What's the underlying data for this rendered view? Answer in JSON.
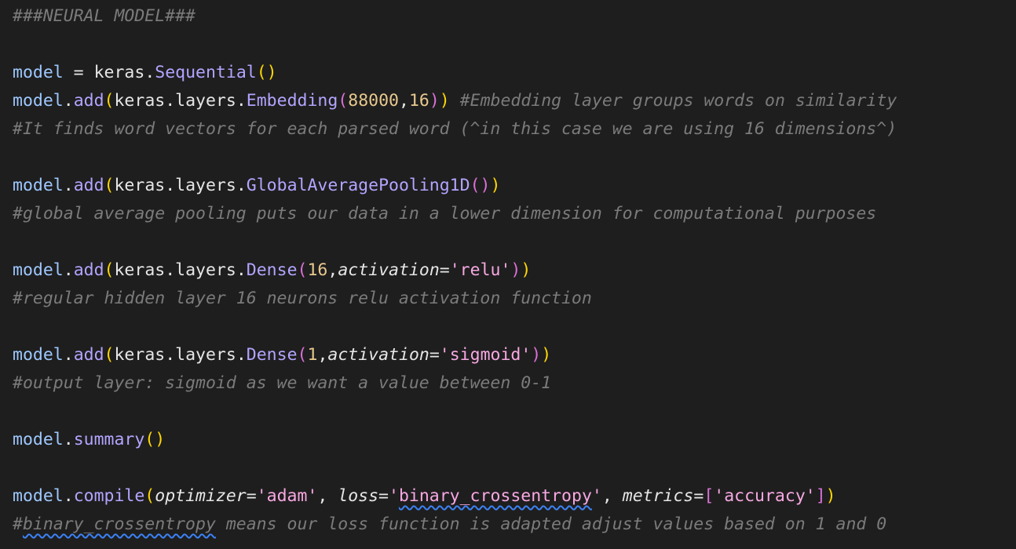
{
  "lines": [
    {
      "tokens": [
        {
          "t": "###NEURAL MODEL###",
          "c": "comment"
        }
      ]
    },
    {
      "tokens": []
    },
    {
      "tokens": [
        {
          "t": "model",
          "c": "var"
        },
        {
          "t": " = ",
          "c": "plain"
        },
        {
          "t": "keras",
          "c": "plain"
        },
        {
          "t": ".",
          "c": "plain"
        },
        {
          "t": "Sequential",
          "c": "fn"
        },
        {
          "t": "()",
          "c": "paren-y"
        }
      ]
    },
    {
      "tokens": [
        {
          "t": "model",
          "c": "var"
        },
        {
          "t": ".",
          "c": "plain"
        },
        {
          "t": "add",
          "c": "fn"
        },
        {
          "t": "(",
          "c": "paren-y"
        },
        {
          "t": "keras",
          "c": "plain"
        },
        {
          "t": ".",
          "c": "plain"
        },
        {
          "t": "layers",
          "c": "plain"
        },
        {
          "t": ".",
          "c": "plain"
        },
        {
          "t": "Embedding",
          "c": "fn"
        },
        {
          "t": "(",
          "c": "paren-p"
        },
        {
          "t": "88000",
          "c": "num"
        },
        {
          "t": ",",
          "c": "plain"
        },
        {
          "t": "16",
          "c": "num"
        },
        {
          "t": ")",
          "c": "paren-p"
        },
        {
          "t": ")",
          "c": "paren-y"
        },
        {
          "t": " ",
          "c": "plain"
        },
        {
          "t": "#Embedding layer groups words on similarity",
          "c": "comment"
        }
      ]
    },
    {
      "tokens": [
        {
          "t": "#It finds word vectors for each parsed word (^in this case we are using 16 dimensions^)",
          "c": "comment"
        }
      ]
    },
    {
      "tokens": []
    },
    {
      "tokens": [
        {
          "t": "model",
          "c": "var"
        },
        {
          "t": ".",
          "c": "plain"
        },
        {
          "t": "add",
          "c": "fn"
        },
        {
          "t": "(",
          "c": "paren-y"
        },
        {
          "t": "keras",
          "c": "plain"
        },
        {
          "t": ".",
          "c": "plain"
        },
        {
          "t": "layers",
          "c": "plain"
        },
        {
          "t": ".",
          "c": "plain"
        },
        {
          "t": "GlobalAveragePooling1D",
          "c": "fn"
        },
        {
          "t": "()",
          "c": "paren-p"
        },
        {
          "t": ")",
          "c": "paren-y"
        }
      ]
    },
    {
      "tokens": [
        {
          "t": "#global average pooling puts our data in a lower dimension for computational purposes",
          "c": "comment"
        }
      ]
    },
    {
      "tokens": []
    },
    {
      "tokens": [
        {
          "t": "model",
          "c": "var"
        },
        {
          "t": ".",
          "c": "plain"
        },
        {
          "t": "add",
          "c": "fn"
        },
        {
          "t": "(",
          "c": "paren-y"
        },
        {
          "t": "keras",
          "c": "plain"
        },
        {
          "t": ".",
          "c": "plain"
        },
        {
          "t": "layers",
          "c": "plain"
        },
        {
          "t": ".",
          "c": "plain"
        },
        {
          "t": "Dense",
          "c": "fn"
        },
        {
          "t": "(",
          "c": "paren-p"
        },
        {
          "t": "16",
          "c": "num"
        },
        {
          "t": ",",
          "c": "plain"
        },
        {
          "t": "activation",
          "c": "param"
        },
        {
          "t": "=",
          "c": "plain"
        },
        {
          "t": "'relu'",
          "c": "str"
        },
        {
          "t": ")",
          "c": "paren-p"
        },
        {
          "t": ")",
          "c": "paren-y"
        }
      ]
    },
    {
      "tokens": [
        {
          "t": "#regular hidden layer 16 neurons relu activation function",
          "c": "comment"
        }
      ]
    },
    {
      "tokens": []
    },
    {
      "tokens": [
        {
          "t": "model",
          "c": "var"
        },
        {
          "t": ".",
          "c": "plain"
        },
        {
          "t": "add",
          "c": "fn"
        },
        {
          "t": "(",
          "c": "paren-y"
        },
        {
          "t": "keras",
          "c": "plain"
        },
        {
          "t": ".",
          "c": "plain"
        },
        {
          "t": "layers",
          "c": "plain"
        },
        {
          "t": ".",
          "c": "plain"
        },
        {
          "t": "Dense",
          "c": "fn"
        },
        {
          "t": "(",
          "c": "paren-p"
        },
        {
          "t": "1",
          "c": "num"
        },
        {
          "t": ",",
          "c": "plain"
        },
        {
          "t": "activation",
          "c": "param"
        },
        {
          "t": "=",
          "c": "plain"
        },
        {
          "t": "'sigmoid'",
          "c": "str"
        },
        {
          "t": ")",
          "c": "paren-p"
        },
        {
          "t": ")",
          "c": "paren-y"
        }
      ]
    },
    {
      "tokens": [
        {
          "t": "#output layer: sigmoid as we want a value between 0-1",
          "c": "comment"
        }
      ]
    },
    {
      "tokens": []
    },
    {
      "tokens": [
        {
          "t": "model",
          "c": "var"
        },
        {
          "t": ".",
          "c": "plain"
        },
        {
          "t": "summary",
          "c": "fn"
        },
        {
          "t": "()",
          "c": "paren-y"
        }
      ]
    },
    {
      "tokens": []
    },
    {
      "tokens": [
        {
          "t": "model",
          "c": "var"
        },
        {
          "t": ".",
          "c": "plain"
        },
        {
          "t": "compile",
          "c": "fn"
        },
        {
          "t": "(",
          "c": "paren-y"
        },
        {
          "t": "optimizer",
          "c": "param"
        },
        {
          "t": "=",
          "c": "plain"
        },
        {
          "t": "'adam'",
          "c": "str"
        },
        {
          "t": ", ",
          "c": "plain"
        },
        {
          "t": "loss",
          "c": "param"
        },
        {
          "t": "=",
          "c": "plain"
        },
        {
          "t": "'",
          "c": "str"
        },
        {
          "t": "binary_crossentropy",
          "c": "str",
          "squiggle": true
        },
        {
          "t": "'",
          "c": "str"
        },
        {
          "t": ", ",
          "c": "plain"
        },
        {
          "t": "metrics",
          "c": "param"
        },
        {
          "t": "=",
          "c": "plain"
        },
        {
          "t": "[",
          "c": "paren-p"
        },
        {
          "t": "'accuracy'",
          "c": "str"
        },
        {
          "t": "]",
          "c": "paren-p"
        },
        {
          "t": ")",
          "c": "paren-y"
        }
      ]
    },
    {
      "tokens": [
        {
          "t": "#",
          "c": "comment"
        },
        {
          "t": "binary_crossentropy",
          "c": "comment",
          "squiggle": true
        },
        {
          "t": " means our loss function is adapted adjust values based on 1 and 0",
          "c": "comment"
        }
      ]
    }
  ],
  "colors": {
    "background": "#1e1e1e",
    "comment": "#7b7b7b",
    "variable": "#9ec8ff",
    "function": "#b4a4ff",
    "bracket_level1": "#ffd700",
    "bracket_level2": "#da70d6",
    "number": "#e8c98e",
    "string": "#f7a8e2",
    "spell_squiggle": "#3b82f6"
  }
}
